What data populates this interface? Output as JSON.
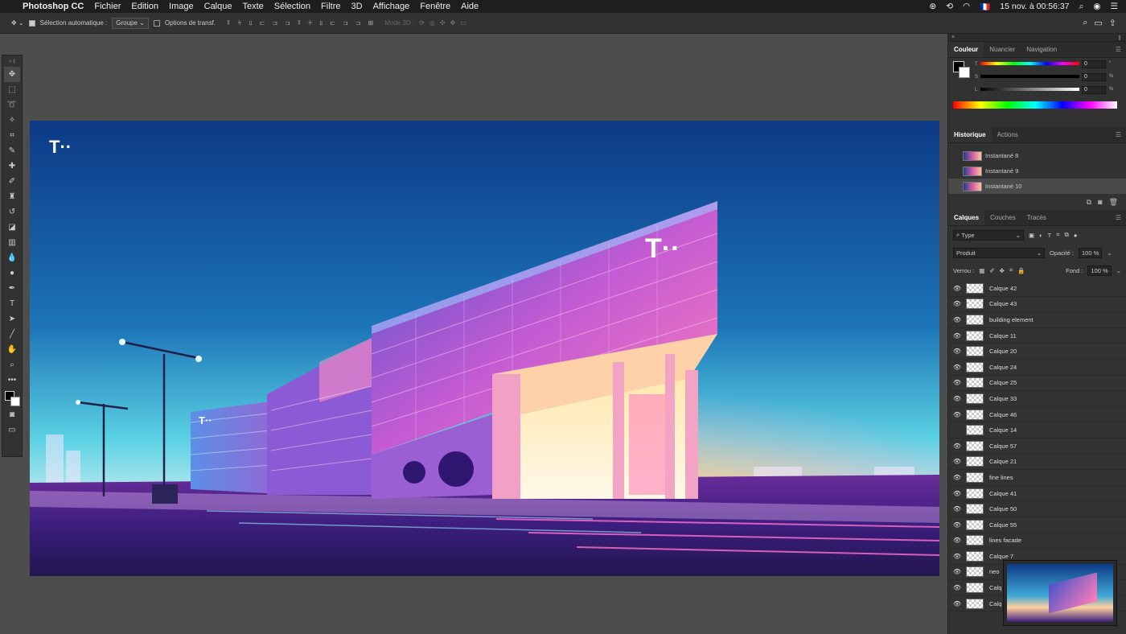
{
  "menubar": {
    "apple": "",
    "items": [
      "Photoshop CC",
      "Fichier",
      "Edition",
      "Image",
      "Calque",
      "Texte",
      "Sélection",
      "Filtre",
      "3D",
      "Affichage",
      "Fenêtre",
      "Aide"
    ],
    "flag": "🇫🇷",
    "datetime": "15 nov. à 00:56:37"
  },
  "options": {
    "auto_select_label": "Sélection automatique :",
    "auto_select_value": "Groupe",
    "transform_label": "Options de transf.",
    "mode3d_label": "Mode 3D :"
  },
  "panels": {
    "color": {
      "tabs": [
        "Couleur",
        "Nuancier",
        "Navigation"
      ],
      "labels": [
        "T",
        "S",
        "L"
      ],
      "values": [
        "0",
        "0",
        "0"
      ],
      "units": [
        "°",
        "%",
        "%"
      ]
    },
    "history": {
      "tabs": [
        "Historique",
        "Actions"
      ],
      "rows": [
        "Instantané 8",
        "Instantané 9",
        "Instantané 10"
      ]
    },
    "layers": {
      "tabs": [
        "Calques",
        "Couches",
        "Tracés"
      ],
      "filter": "Type",
      "blend_mode": "Produit",
      "opacity_label": "Opacité :",
      "opacity": "100 %",
      "lock_label": "Verrou :",
      "fill_label": "Fond :",
      "fill": "100 %",
      "rows": [
        "Calque 42",
        "Calque 43",
        "building element",
        "Calque 11",
        "Calque 20",
        "Calque 24",
        "Calque 25",
        "Calque 33",
        "Calque 46",
        "Calque 14",
        "Calque 57",
        "Calque 21",
        "fine lines",
        "Calque 41",
        "Calque 50",
        "Calque 55",
        "lines facade",
        "Calque 7",
        "neo",
        "Calq",
        "Calq"
      ]
    }
  },
  "canvas": {
    "brand_logo": "T··"
  },
  "colors": {
    "menubar": "#1e1e1e",
    "panel": "#323232",
    "workspace": "#4d4d4d",
    "magenta": "#e20074"
  }
}
